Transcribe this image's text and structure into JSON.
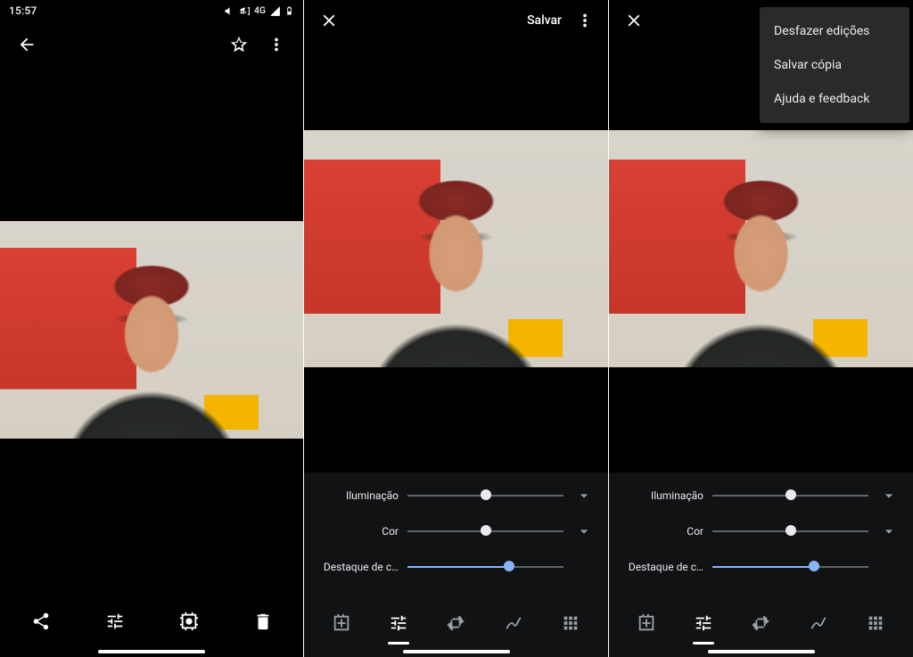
{
  "status": {
    "time": "15:57",
    "network_label": "4G"
  },
  "pane1": {
    "actions": {
      "back": "back",
      "favorite": "favorite",
      "more": "more"
    },
    "bottom": {
      "share": "share",
      "edit": "edit",
      "lens": "lens",
      "delete": "delete"
    }
  },
  "editor": {
    "close": "close",
    "save_label": "Salvar",
    "more": "more",
    "sliders": [
      {
        "label": "Iluminação",
        "pos": 50,
        "expandable": true,
        "tint": "neutral"
      },
      {
        "label": "Cor",
        "pos": 50,
        "expandable": true,
        "tint": "neutral"
      },
      {
        "label": "Destaque de c…",
        "pos": 65,
        "expandable": false,
        "tint": "blue"
      }
    ],
    "tools": [
      {
        "name": "suggestions",
        "selected": false
      },
      {
        "name": "adjust",
        "selected": true
      },
      {
        "name": "crop",
        "selected": false
      },
      {
        "name": "markup",
        "selected": false
      },
      {
        "name": "more-grid",
        "selected": false
      }
    ]
  },
  "overflow_menu": {
    "items": [
      {
        "label": "Desfazer edições"
      },
      {
        "label": "Salvar cópia"
      },
      {
        "label": "Ajuda e feedback"
      }
    ]
  }
}
